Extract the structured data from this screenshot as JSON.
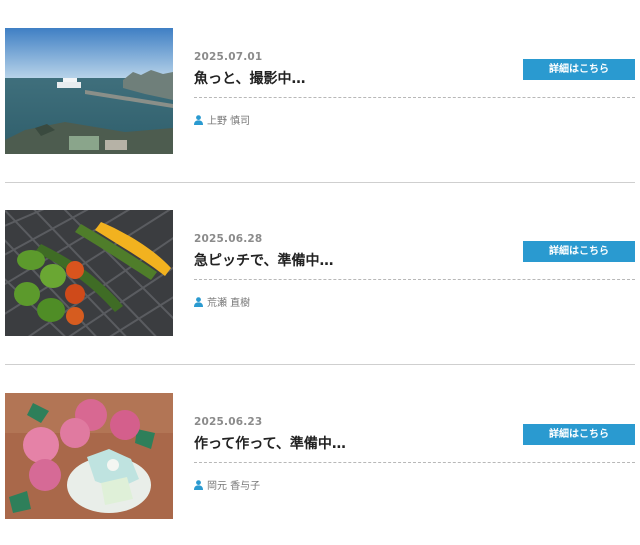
{
  "posts": [
    {
      "date": "2025.07.01",
      "title": "魚っと、撮影中…",
      "button_label": "詳細はこちら",
      "author": "上野 慎司",
      "thumbnail_icon": "harbor-photo"
    },
    {
      "date": "2025.06.28",
      "title": "急ピッチで、準備中…",
      "button_label": "詳細はこちら",
      "author": "荒瀬 直樹",
      "thumbnail_icon": "vegetables-photo"
    },
    {
      "date": "2025.06.23",
      "title": "作って作って、準備中…",
      "button_label": "詳細はこちら",
      "author": "岡元 香与子",
      "thumbnail_icon": "flowers-photo"
    }
  ],
  "colors": {
    "accent": "#2a9ad0",
    "date_text": "#8b8b8b",
    "separator": "#cfcfcf"
  }
}
